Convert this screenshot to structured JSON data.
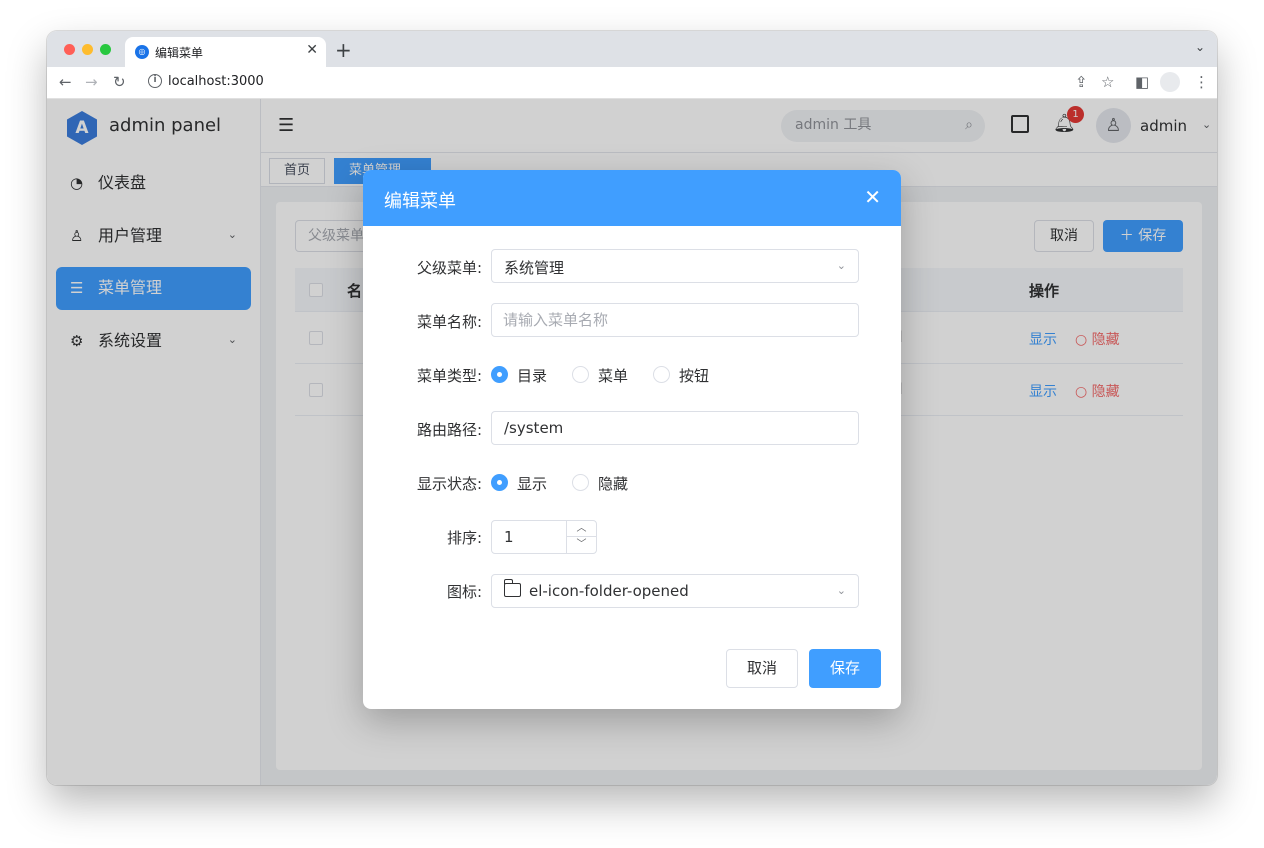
{
  "browser": {
    "tab_title": "编辑菜单",
    "url": "localhost:3000",
    "traffic_colors": [
      "#ff5f57",
      "#febc2e",
      "#28c840"
    ]
  },
  "sidebar": {
    "logo_letter": "A",
    "app_name": "admin panel",
    "items": [
      {
        "label": "仪表盘",
        "icon": "dashboard-icon",
        "active": false,
        "has_arrow": false
      },
      {
        "label": "用户管理",
        "icon": "user-icon",
        "active": false,
        "has_arrow": true
      },
      {
        "label": "菜单管理",
        "icon": "list-icon",
        "active": true,
        "has_arrow": false
      },
      {
        "label": "系统设置",
        "icon": "gear-icon",
        "active": false,
        "has_arrow": true
      }
    ]
  },
  "navbar": {
    "search_placeholder": "admin 工具",
    "notification_count": "1",
    "user_name": "admin"
  },
  "tags": {
    "home": "首页",
    "active": "菜单管理"
  },
  "page": {
    "filter_placeholder": "父级菜单",
    "cancel_label": "取消",
    "save_label": "保存",
    "table": {
      "col_name": "名",
      "col_ops": "操作",
      "rows": [
        {
          "icon": "ened",
          "show": "显示",
          "hide": "隐藏"
        },
        {
          "icon": "ened",
          "show": "显示",
          "hide": "隐藏"
        }
      ]
    }
  },
  "dialog": {
    "title": "编辑菜单",
    "fields": {
      "parent": {
        "label": "父级菜单:",
        "value": "系统管理"
      },
      "name": {
        "label": "菜单名称:",
        "value": "",
        "placeholder": "请输入菜单名称"
      },
      "type": {
        "label": "菜单类型:",
        "options": [
          "目录",
          "菜单",
          "按钮"
        ],
        "selected": "目录"
      },
      "path": {
        "label": "路由路径:",
        "value": "/system"
      },
      "status": {
        "label": "显示状态:",
        "options": [
          "显示",
          "隐藏"
        ],
        "selected": "显示"
      },
      "order": {
        "label": "排序:",
        "value": "1"
      },
      "icon": {
        "label": "图标:",
        "value": "el-icon-folder-opened"
      }
    },
    "cancel_label": "取消",
    "save_label": "保存"
  },
  "colors": {
    "primary": "#409eff",
    "danger": "#f56c6c",
    "badge": "#e53935"
  }
}
